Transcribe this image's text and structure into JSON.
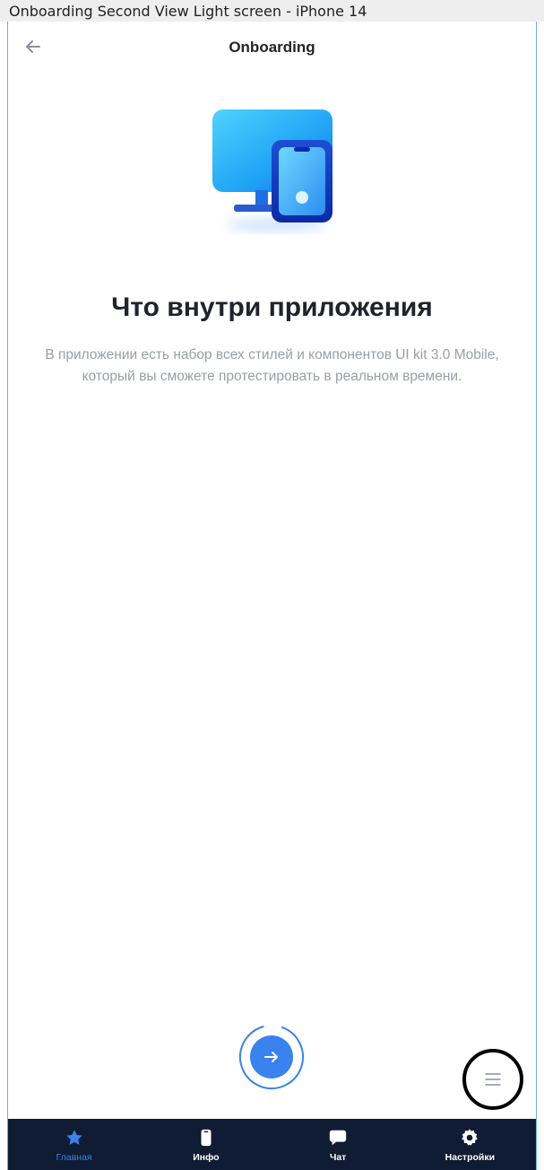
{
  "frame": {
    "caption": "Onboarding Second View Light screen - iPhone 14"
  },
  "header": {
    "title": "Onboarding"
  },
  "content": {
    "headline": "Что внутри приложения",
    "description": "В приложении есть набор всех стилей и компонентов UI kit 3.0 Mobile, который вы сможете протестировать в реальном времени."
  },
  "actions": {
    "next_icon": "arrow-right-icon",
    "menu_icon": "hamburger-icon",
    "progress": 0.9
  },
  "tabs": [
    {
      "label": "Главная",
      "icon": "star-icon",
      "active": true
    },
    {
      "label": "Инфо",
      "icon": "phone-icon",
      "active": false
    },
    {
      "label": "Чат",
      "icon": "chat-bubble-icon",
      "active": false
    },
    {
      "label": "Настройки",
      "icon": "gear-icon",
      "active": false
    }
  ],
  "colors": {
    "accent": "#3a82ee",
    "tab_bar": "#101c33",
    "text": "#20232b",
    "muted": "#9a9ea8"
  }
}
